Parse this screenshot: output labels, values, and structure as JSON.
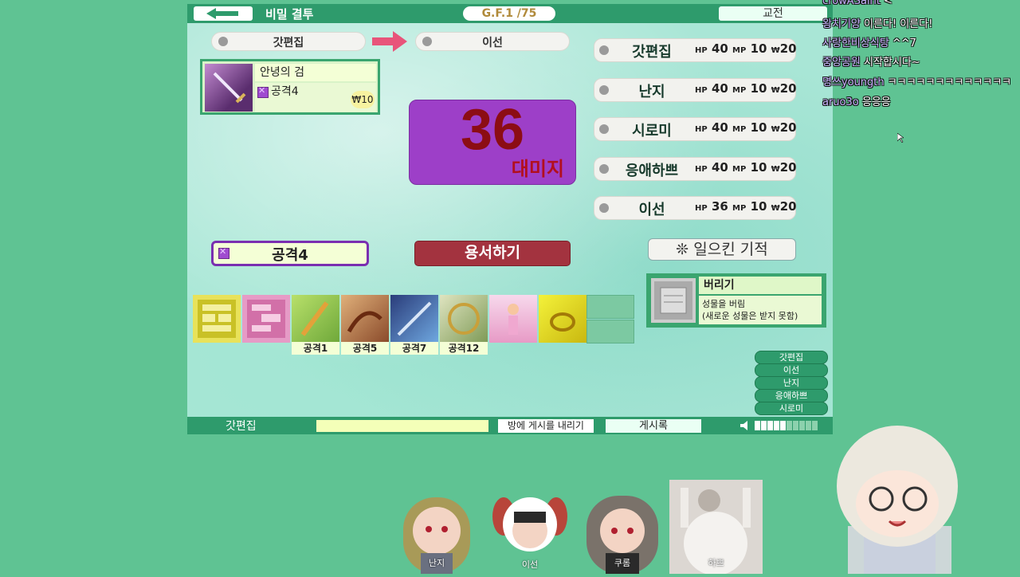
{
  "header": {
    "title": "비밀 결투",
    "gf": "G.F.1 /75",
    "exchange": "교전"
  },
  "turn": {
    "from": "갓편집",
    "to": "이선"
  },
  "card": {
    "name": "안녕의 검",
    "attack": "공격4",
    "cost": "₩10"
  },
  "damage": {
    "value": "36",
    "label": "대미지"
  },
  "players": [
    {
      "name": "갓편집",
      "hp": "40",
      "mp": "10",
      "won": "20"
    },
    {
      "name": "난지",
      "hp": "40",
      "mp": "10",
      "won": "20"
    },
    {
      "name": "시로미",
      "hp": "40",
      "mp": "10",
      "won": "20"
    },
    {
      "name": "응애하쁘",
      "hp": "40",
      "mp": "10",
      "won": "20"
    },
    {
      "name": "이선",
      "hp": "36",
      "mp": "10",
      "won": "20"
    }
  ],
  "stat_labels": {
    "hp": "HP",
    "mp": "MP",
    "won": "₩"
  },
  "actions": {
    "attack_select": "공격4",
    "forgive": "용서하기",
    "miracle": "일으킨 기적"
  },
  "inventory": {
    "labels": [
      "공격1",
      "공격5",
      "공격7",
      "공격12"
    ]
  },
  "discard": {
    "title": "버리기",
    "desc1": "성물을 버림",
    "desc2": "(새로운 성물은 받지 못함)"
  },
  "order": [
    "갓편집",
    "이선",
    "난지",
    "응애하쁘",
    "시로미"
  ],
  "bottom": {
    "player": "갓편집",
    "post": "방에 게시를 내리기",
    "board": "게시록"
  },
  "chat": [
    {
      "user": "crowASaint",
      "msg": "<^^"
    },
    {
      "user": "왕치기양",
      "msg": "이른다! 이른다!"
    },
    {
      "user": "사랑한비상식탕",
      "msg": "^^7"
    },
    {
      "user": "중앙공원",
      "msg": "시작합시다~"
    },
    {
      "user": "명쓰youngth",
      "msg": "ㅋㅋㅋㅋㅋㅋㅋㅋㅋㅋㅋㅋㅋ"
    },
    {
      "user": "aruo3o",
      "msg": "응응응"
    }
  ],
  "avatars": {
    "a1": "난지",
    "a2": "이선",
    "a3": "쿠롬",
    "a4": "하쁘"
  },
  "colors": {
    "accent": "#2e9b6c",
    "damage_bg": "#9d3fc8",
    "forgive_bg": "#a3333f"
  }
}
